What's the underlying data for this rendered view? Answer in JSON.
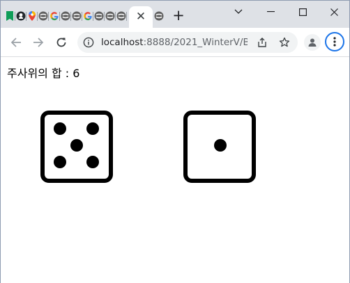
{
  "browser": {
    "tabs": [
      {
        "icon": "green-bookmark-icon"
      },
      {
        "icon": "github-icon"
      },
      {
        "icon": "maps-pin-icon"
      },
      {
        "icon": "jupyter-icon"
      },
      {
        "icon": "google-g-icon"
      },
      {
        "icon": "jupyter-icon"
      },
      {
        "icon": "jupyter-icon"
      },
      {
        "icon": "google-g-icon"
      },
      {
        "icon": "jupyter-icon"
      },
      {
        "icon": "jupyter-icon"
      },
      {
        "icon": "jupyter-icon"
      }
    ],
    "active_tab": {
      "close_label": "✕"
    },
    "new_tab_label": "+",
    "address": {
      "host": "localhost",
      "path": ":8888/2021_WinterV/B..."
    }
  },
  "page": {
    "sum_text": "주사위의 합 : 6",
    "dice": [
      {
        "name": "die-five",
        "value": 5
      },
      {
        "name": "die-one",
        "value": 1
      }
    ]
  },
  "colors": {
    "tabstrip": "#dee1e6",
    "omnibox": "#f1f3f4",
    "accent": "#1a73e8"
  }
}
